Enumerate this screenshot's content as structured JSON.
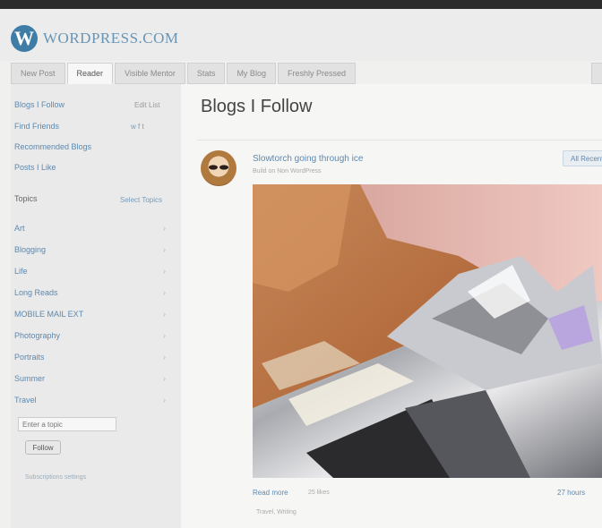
{
  "header": {
    "logo_glyph": "W",
    "logo_text": "WORDPRESS.COM",
    "tabs": [
      "New Post",
      "Reader",
      "Visible Mentor",
      "Stats",
      "My Blog",
      "Freshly Pressed"
    ]
  },
  "sidebar": {
    "items": [
      {
        "label": "Blogs I Follow",
        "right": "Edit List"
      },
      {
        "label": "Find Friends",
        "right": "w f t"
      },
      {
        "label": "Recommended Blogs",
        "right": ""
      },
      {
        "label": "Posts I Like",
        "right": ""
      }
    ],
    "topics_heading": "Topics",
    "topics_action": "Select Topics",
    "topics": [
      "Art",
      "Blogging",
      "Life",
      "Long Reads",
      "MOBILE MAIL EXT",
      "Photography",
      "Portraits",
      "Summer",
      "Travel"
    ],
    "topic_placeholder": "Enter a topic",
    "follow_label": "Follow",
    "settings_link": "Subscriptions settings"
  },
  "main": {
    "title": "Blogs I Follow",
    "post": {
      "title": "Slowtorch going through ice",
      "subtitle": "Build on Non WordPress",
      "all_button": "All Recent",
      "read_more": "Read more",
      "read_meta": "25 likes",
      "time": "27 hours",
      "tags": "Travel, Writing"
    }
  },
  "colors": {
    "link": "#5d89b0",
    "brand": "#3f7da6"
  }
}
